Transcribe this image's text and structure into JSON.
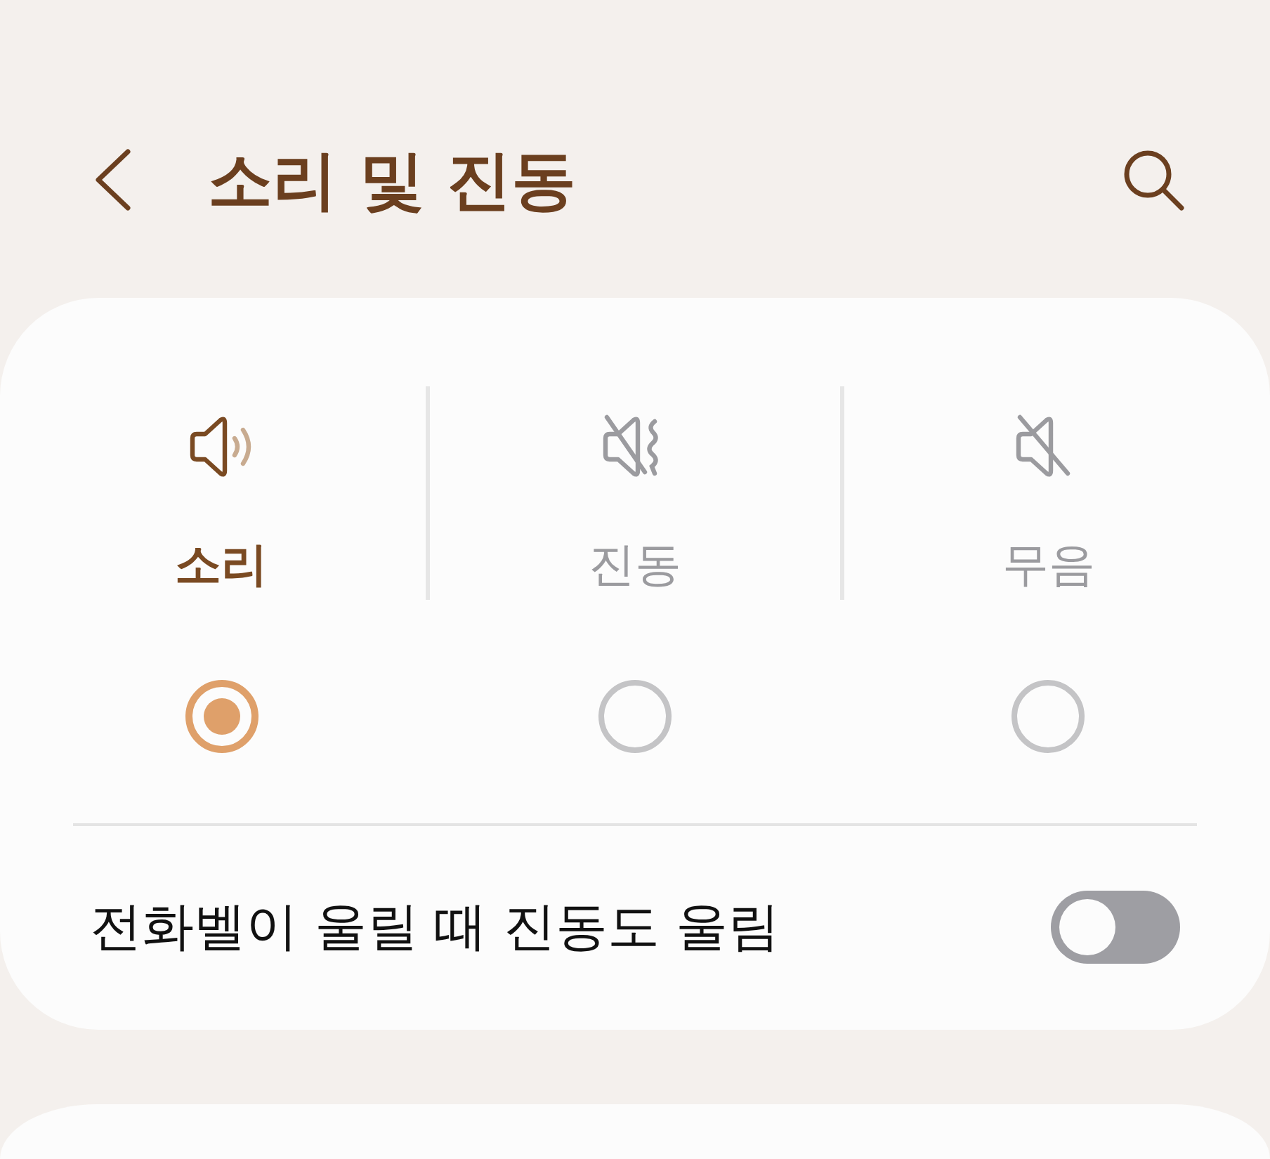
{
  "header": {
    "title": "소리 및 진동"
  },
  "sound_modes": [
    {
      "kind": "sound",
      "label": "소리",
      "selected": true
    },
    {
      "kind": "vibrate",
      "label": "진동",
      "selected": false
    },
    {
      "kind": "mute",
      "label": "무음",
      "selected": false
    }
  ],
  "settings": [
    {
      "label": "전화벨이 울릴 때 진동도 울림",
      "on": false
    }
  ]
}
